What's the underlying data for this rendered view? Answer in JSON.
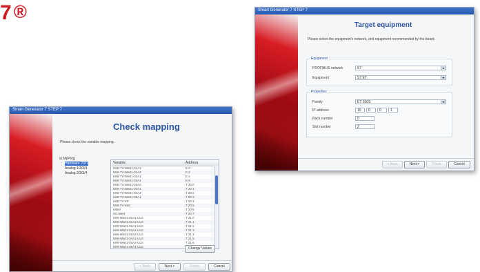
{
  "brand": {
    "text": "7",
    "symbol": "®",
    "color": "#d11a24"
  },
  "check_mapping": {
    "window_title": "Smart Generator 7 STEP 7",
    "heading": "Check mapping",
    "instruction": "Please check the variable mapping.",
    "tree": [
      {
        "label": "MyProg",
        "selected": false
      },
      {
        "label": "Hardware 2/2/1",
        "selected": true
      },
      {
        "label": "Analog 1/2/3/4",
        "selected": false
      },
      {
        "label": "Analog 2/2/3/4",
        "selected": false
      }
    ],
    "table": {
      "columns": [
        "Variable",
        "Address"
      ],
      "rows": [
        {
          "variable": "MHI-TV-Wert1-01A1",
          "address": "E 0"
        },
        {
          "variable": "MHI-TV-Wert1-01A2",
          "address": "E 2"
        },
        {
          "variable": "MHI-TV-Wert1-02A1",
          "address": "E 4"
        },
        {
          "variable": "MHI-TV-Wert1-03A1",
          "address": "E 6"
        },
        {
          "variable": "MHI-TV-Wert1-03A2",
          "address": "T 20 0"
        },
        {
          "variable": "MHI-TV-Wert1-04A1",
          "address": "T 20 1"
        },
        {
          "variable": "MHI-TV-Wert1-04A2",
          "address": "T 20 2"
        },
        {
          "variable": "MHI-TV-Wert1-05A1",
          "address": "T 20 3"
        },
        {
          "variable": "MHI-TV-SP",
          "address": "T 20 4"
        },
        {
          "variable": "MHI-TV-Stat",
          "address": "T 20 5"
        },
        {
          "variable": "Mittel",
          "address": "T 20 6"
        },
        {
          "variable": "AC-Wert",
          "address": "T 20 7"
        },
        {
          "variable": "MHI-Wert1-01A1-ULS",
          "address": "T 21 0"
        },
        {
          "variable": "MHI-Wert1-01A2-ULS",
          "address": "T 21 1"
        },
        {
          "variable": "MHI-Wert1-02A1-ULS",
          "address": "T 21 2"
        },
        {
          "variable": "MHI-Wert1-03A1-ULS",
          "address": "T 21 3"
        },
        {
          "variable": "MHI-Wert1-03A2-ULS",
          "address": "T 21 4"
        },
        {
          "variable": "MHI-Wert1-04A1-ULS",
          "address": "T 21 5"
        },
        {
          "variable": "MHI-Wert1-04A2-ULS",
          "address": "T 21 6"
        },
        {
          "variable": "MHI-Wert1-05A1-ULS",
          "address": "T 21 7"
        }
      ]
    },
    "change_button": "Change Values",
    "back_button": "< Back",
    "next_button": "Next >",
    "finish_button": "Finish",
    "cancel_button": "Cancel"
  },
  "target_equipment": {
    "window_title": "Smart Generator 7 STEP 7",
    "heading": "Target equipment",
    "instruction": "Please select the equipment's network, and equipment recommended by the board.",
    "equipment_group": {
      "title": "Equipment",
      "network_label": "PROFIBUS network",
      "network_value": "S7",
      "equipment_label": "Equipment",
      "equipment_value": "S7 ET"
    },
    "properties_group": {
      "title": "Properties",
      "family_label": "Family",
      "family_value": "ET 200S",
      "ip_label": "IP address",
      "ip_values": [
        "10",
        "0",
        "0",
        "1"
      ],
      "rack_label": "Rack number",
      "rack_value": "0",
      "slot_label": "Slot number",
      "slot_value": "2"
    },
    "back_button": "< Back",
    "next_button": "Next >",
    "finish_button": "Finish",
    "cancel_button": "Cancel"
  }
}
